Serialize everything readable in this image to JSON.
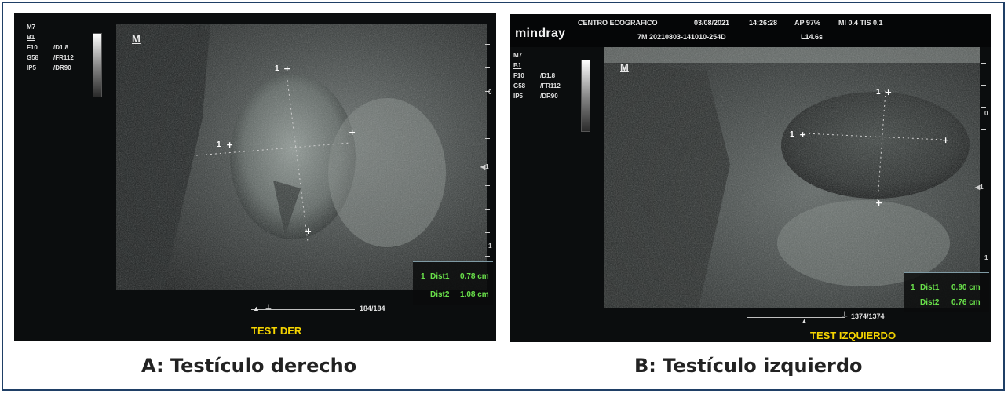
{
  "panel_a": {
    "params": [
      "M7",
      "B1",
      "F10",
      "/D1.8",
      "G58",
      "/FR112",
      "IP5",
      "/DR90"
    ],
    "marker_m": "M",
    "caliper_labels": [
      "1",
      "1"
    ],
    "depth_marks": [
      "0",
      "1"
    ],
    "measurements": [
      {
        "index": "1",
        "label": "Dist1",
        "value": "0.78 cm"
      },
      {
        "index": "",
        "label": "Dist2",
        "value": "1.08 cm"
      }
    ],
    "cine_counter": "184/184",
    "test_label": "TEST DER"
  },
  "panel_b": {
    "brand": "mindray",
    "header": {
      "center": "CENTRO ECOGRAFICO",
      "date": "03/08/2021",
      "time": "14:26:28",
      "ap": "AP 97%",
      "mi_tis": "MI 0.4 TIS 0.1",
      "exam_id": "7M 20210803-141010-254D",
      "probe": "L14.6s"
    },
    "params": [
      "M7",
      "B1",
      "F10",
      "/D1.8",
      "G58",
      "/FR112",
      "IP5",
      "/DR90"
    ],
    "marker_m": "M",
    "caliper_labels": [
      "1",
      "1"
    ],
    "depth_marks": [
      "0",
      "1"
    ],
    "measurements": [
      {
        "index": "1",
        "label": "Dist1",
        "value": "0.90 cm"
      },
      {
        "index": "",
        "label": "Dist2",
        "value": "0.76 cm"
      }
    ],
    "cine_counter": "1374/1374",
    "test_label": "TEST IZQUIERDO"
  },
  "captions": {
    "a": "A: Testículo derecho",
    "b": "B: Testículo izquierdo"
  },
  "colors": {
    "measurement_text": "#69e04a",
    "test_label": "#f5d400",
    "frame_border": "#1f3f66"
  }
}
